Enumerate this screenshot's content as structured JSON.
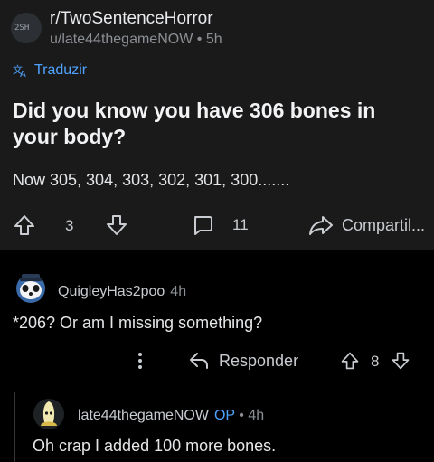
{
  "post": {
    "subreddit": "r/TwoSentenceHorror",
    "subreddit_avatar_text": "2SH",
    "author": "u/late44thegameNOW",
    "separator": "•",
    "age": "5h",
    "translate_label": "Traduzir",
    "title": "Did you know you have 306 bones in your body?",
    "body": "Now 305, 304, 303, 302, 301, 300.......",
    "score": "3",
    "comments": "11",
    "share_label": "Compartil..."
  },
  "comment1": {
    "username": "QuigleyHas2poo",
    "age": "4h",
    "body": "*206? Or am I missing something?",
    "reply_label": "Responder",
    "score": "8"
  },
  "comment2": {
    "username": "late44thegameNOW",
    "op_badge": "OP",
    "separator": "•",
    "age": "4h",
    "body": "Oh crap I added 100 more bones."
  },
  "icons": {
    "translate": "translate-icon",
    "upvote": "upvote-arrow-icon",
    "downvote": "downvote-arrow-icon",
    "comment": "comment-bubble-icon",
    "share": "share-arrow-icon",
    "more": "more-vertical-icon",
    "reply": "reply-arrow-icon"
  },
  "colors": {
    "background": "#000000",
    "post_background": "#1a1a1b",
    "accent_blue": "#4fa3ff",
    "text_primary": "#e4e6e8",
    "text_muted": "#8b8f93"
  }
}
